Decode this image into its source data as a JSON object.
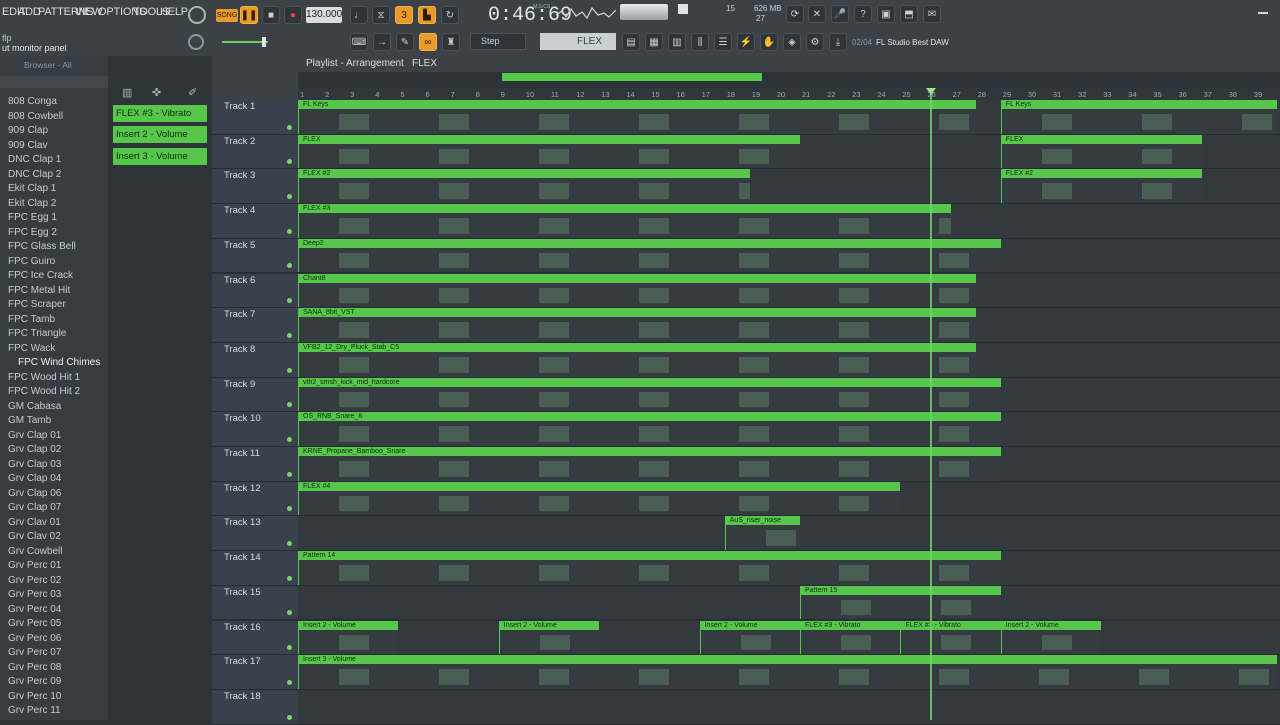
{
  "menu": [
    "EDIT",
    "ADD",
    "PATTERNS",
    "VIEW",
    "OPTIONS",
    "TOOLS",
    "HELP"
  ],
  "song_label": "SONG",
  "tempo": "130.000",
  "time": "0:46:69",
  "time_unit": "M:S:CS",
  "cpu": "15",
  "mem": "626 MB",
  "mem2": "27",
  "pattern_name": "FLEX",
  "snap": "Step",
  "hint_index": "02/04",
  "hint_text": "FL Studio Best DAW",
  "file_hint": "flp",
  "monitor_label": "ut monitor panel",
  "browser_title": "Browser - All",
  "playlist_title": "Playlist - Arrangement",
  "playlist_pattern": "FLEX",
  "browser_items": [
    "808 Conga",
    "808 Cowbell",
    "909 Clap",
    "909 Clav",
    "DNC Clap 1",
    "DNC Clap 2",
    "Ekit Clap 1",
    "Ekit Clap 2",
    "FPC Egg 1",
    "FPC Egg 2",
    "FPC Glass Bell",
    "FPC Guiro",
    "FPC Ice Crack",
    "FPC Metal Hit",
    "FPC Scraper",
    "FPC Tamb",
    "FPC Triangle",
    "FPC Wack",
    "FPC Wind Chimes",
    "FPC Wood Hit 1",
    "FPC Wood Hit 2",
    "GM Cabasa",
    "GM Tamb",
    "Grv Clap 01",
    "Grv Clap 02",
    "Grv Clap 03",
    "Grv Clap 04",
    "Grv Clap 06",
    "Grv Clap 07",
    "Grv Clav 01",
    "Grv Clav 02",
    "Grv Cowbell",
    "Grv Perc 01",
    "Grv Perc 02",
    "Grv Perc 03",
    "Grv Perc 04",
    "Grv Perc 05",
    "Grv Perc 06",
    "Grv Perc 07",
    "Grv Perc 08",
    "Grv Perc 09",
    "Grv Perc 10",
    "Grv Perc 11"
  ],
  "selected_browser_item": "FPC Wind Chimes",
  "clip_buttons": [
    "FLEX #3 - Vibrato",
    "Insert 2 - Volume",
    "Insert 3 - Volume"
  ],
  "ruler": [
    "1",
    "2",
    "3",
    "4",
    "5",
    "6",
    "7",
    "8",
    "9",
    "10",
    "11",
    "12",
    "13",
    "14",
    "15",
    "16",
    "17",
    "18",
    "19",
    "20",
    "21",
    "22",
    "23",
    "24",
    "25",
    "26",
    "27",
    "28",
    "29",
    "30",
    "31",
    "32",
    "33",
    "34",
    "35",
    "36",
    "37",
    "38",
    "39"
  ],
  "tracks": [
    {
      "label": "Track 1",
      "clips": [
        {
          "name": "FL Keys",
          "start": 1,
          "end": 28
        },
        {
          "name": "FL Keys",
          "start": 29,
          "end": 40
        }
      ]
    },
    {
      "label": "Track 2",
      "clips": [
        {
          "name": "FLEX",
          "start": 1,
          "end": 21
        },
        {
          "name": "FLEX",
          "start": 29,
          "end": 37
        }
      ]
    },
    {
      "label": "Track 3",
      "clips": [
        {
          "name": "FLEX #2",
          "start": 1,
          "end": 19
        },
        {
          "name": "FLEX #2",
          "start": 29,
          "end": 37
        }
      ]
    },
    {
      "label": "Track 4",
      "clips": [
        {
          "name": "FLEX #3",
          "start": 1,
          "end": 27
        }
      ]
    },
    {
      "label": "Track 5",
      "clips": [
        {
          "name": "Deep2",
          "start": 1,
          "end": 29
        }
      ]
    },
    {
      "label": "Track 6",
      "clips": [
        {
          "name": "Chant8",
          "start": 1,
          "end": 28
        }
      ]
    },
    {
      "label": "Track 7",
      "clips": [
        {
          "name": "SANA_8bit_VST",
          "start": 1,
          "end": 28
        }
      ]
    },
    {
      "label": "Track 8",
      "clips": [
        {
          "name": "VFB2_12_Dry_Pluck_Stab_C5",
          "start": 1,
          "end": 28
        }
      ]
    },
    {
      "label": "Track 9",
      "clips": [
        {
          "name": "vth2_smsh_kick_mid_hardcore",
          "start": 1,
          "end": 29
        }
      ]
    },
    {
      "label": "Track 10",
      "clips": [
        {
          "name": "OS_RNB_Snare_8",
          "start": 1,
          "end": 29
        }
      ]
    },
    {
      "label": "Track 11",
      "clips": [
        {
          "name": "KRNE_Propane_Bamboo_Snare",
          "start": 1,
          "end": 29
        }
      ]
    },
    {
      "label": "Track 12",
      "clips": [
        {
          "name": "FLEX #4",
          "start": 1,
          "end": 25
        }
      ]
    },
    {
      "label": "Track 13",
      "clips": [
        {
          "name": "AuS_riser_noise",
          "start": 18,
          "end": 21
        }
      ]
    },
    {
      "label": "Track 14",
      "clips": [
        {
          "name": "Pattern 14",
          "start": 1,
          "end": 29
        }
      ]
    },
    {
      "label": "Track 15",
      "clips": [
        {
          "name": "Pattern 15",
          "start": 21,
          "end": 29
        }
      ]
    },
    {
      "label": "Track 16",
      "clips": [
        {
          "name": "Insert 2 - Volume",
          "start": 1,
          "end": 5
        },
        {
          "name": "Insert 2 - Volume",
          "start": 9,
          "end": 13
        },
        {
          "name": "Insert 2 - Volume",
          "start": 17,
          "end": 21
        },
        {
          "name": "FLEX #3 - Vibrato",
          "start": 21,
          "end": 25
        },
        {
          "name": "FLEX #3 - Vibrato",
          "start": 25,
          "end": 29
        },
        {
          "name": "Insert 2 - Volume",
          "start": 29,
          "end": 33
        }
      ]
    },
    {
      "label": "Track 17",
      "clips": [
        {
          "name": "Insert 3 - Volume",
          "start": 1,
          "end": 40
        }
      ]
    },
    {
      "label": "Track 18",
      "clips": []
    }
  ],
  "colors": {
    "clip": "#57c74b",
    "accent": "#e89b28",
    "background": "#2b3238"
  }
}
